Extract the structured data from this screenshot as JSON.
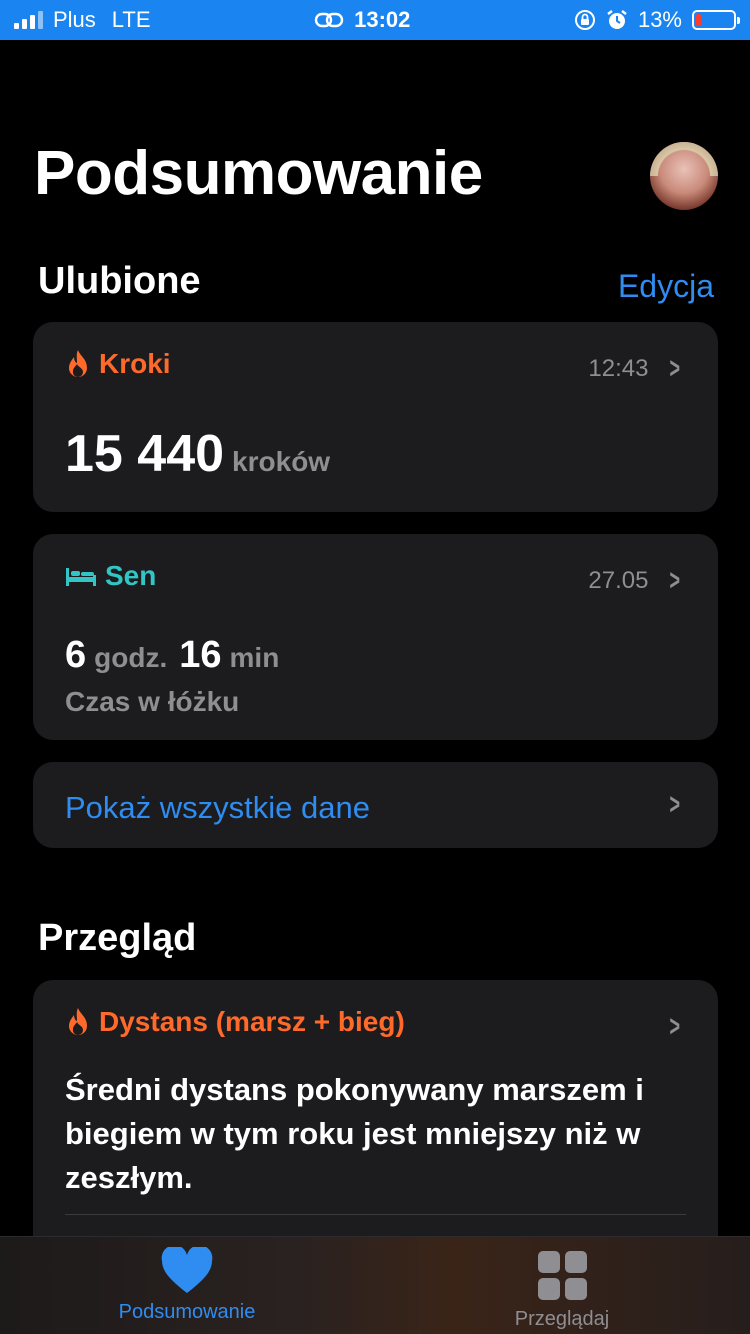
{
  "status_bar": {
    "carrier": "Plus",
    "network": "LTE",
    "time": "13:02",
    "battery_percent": "13%",
    "battery_level": 0.13,
    "battery_color": "#ff3b30",
    "bar_color": "#1a84f0"
  },
  "header": {
    "title": "Podsumowanie"
  },
  "favorites": {
    "section_title": "Ulubione",
    "edit_label": "Edycja",
    "steps": {
      "title": "Kroki",
      "icon": "flame-icon",
      "color": "#ff6a2a",
      "time": "12:43",
      "value": "15 440",
      "unit": "kroków"
    },
    "sleep": {
      "title": "Sen",
      "icon": "bed-icon",
      "color": "#32c5c5",
      "date": "27.05",
      "hours": "6",
      "hours_unit": "godz.",
      "minutes": "16",
      "minutes_unit": "min",
      "caption": "Czas w łóżku"
    },
    "show_all_label": "Pokaż wszystkie dane"
  },
  "overview": {
    "section_title": "Przegląd",
    "card": {
      "title": "Dystans (marsz + bieg)",
      "icon": "flame-icon",
      "color": "#ff6a2a",
      "text": "Średni dystans pokonywany marszem i biegiem w tym roku jest mniejszy niż w zeszłym."
    }
  },
  "tab_bar": {
    "tabs": [
      {
        "label": "Podsumowanie",
        "icon": "heart-icon",
        "active": true
      },
      {
        "label": "Przeglądaj",
        "icon": "grid-icon",
        "active": false
      }
    ],
    "accent": "#2f8cf0"
  }
}
